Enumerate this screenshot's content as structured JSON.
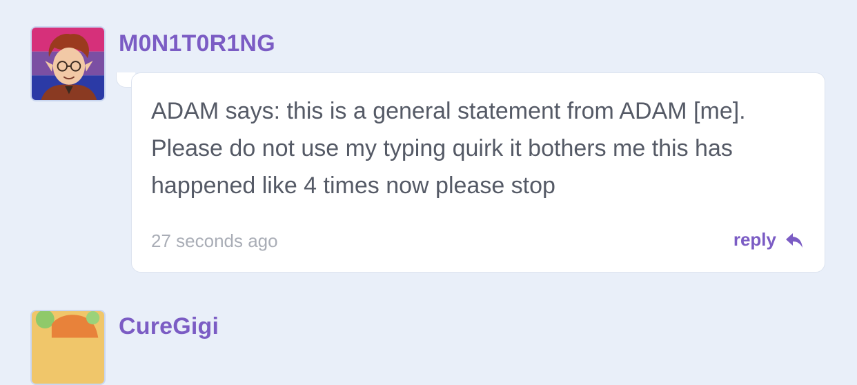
{
  "comments": [
    {
      "username": "M0N1T0R1NG",
      "text": "ADAM says: this is a general statement from ADAM [me]. Please do not use my typing quirk it bothers me this has happened like 4 times now please stop",
      "timestamp": "27 seconds ago",
      "reply_label": "reply"
    },
    {
      "username": "CureGigi"
    }
  ],
  "colors": {
    "background": "#e9eff9",
    "username": "#7b5cc4",
    "body_text": "#555a66",
    "timestamp": "#a9adb6",
    "bubble": "#ffffff"
  },
  "icons": {
    "reply": "reply-arrow-icon"
  }
}
